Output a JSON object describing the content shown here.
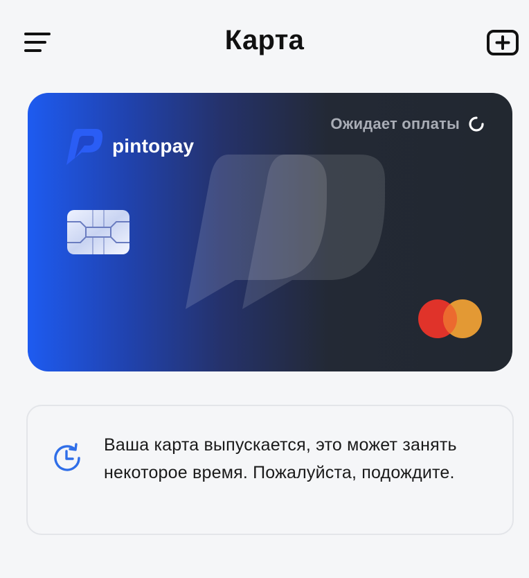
{
  "header": {
    "title": "Карта",
    "menu_icon": "menu-icon",
    "add_icon": "add-card-icon"
  },
  "card": {
    "brand_name": "pintopay",
    "status_text": "Ожидает оплаты",
    "status_icon": "spinner-icon",
    "network": "mastercard",
    "colors": {
      "gradient_start": "#1e5bf0",
      "gradient_end": "#222830",
      "mc_red": "#e0332a",
      "mc_orange": "#ee9f35"
    }
  },
  "notice": {
    "icon": "clock-refresh-icon",
    "text": "Ваша карта выпускается, это может занять некоторое время. Пожалуйста, подождите.",
    "icon_color": "#2f6ee8"
  }
}
